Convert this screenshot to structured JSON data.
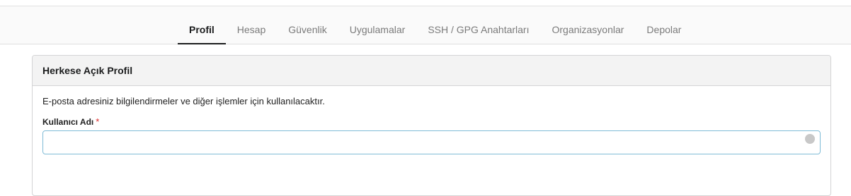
{
  "tabs": [
    {
      "label": "Profil",
      "active": true
    },
    {
      "label": "Hesap",
      "active": false
    },
    {
      "label": "Güvenlik",
      "active": false
    },
    {
      "label": "Uygulamalar",
      "active": false
    },
    {
      "label": "SSH / GPG Anahtarları",
      "active": false
    },
    {
      "label": "Organizasyonlar",
      "active": false
    },
    {
      "label": "Depolar",
      "active": false
    }
  ],
  "panel": {
    "title": "Herkese Açık Profil",
    "help_text": "E-posta adresiniz bilgilendirmeler ve diğer işlemler için kullanılacaktır.",
    "username_label": "Kullanıcı Adı",
    "required_mark": "*",
    "username_value": ""
  }
}
